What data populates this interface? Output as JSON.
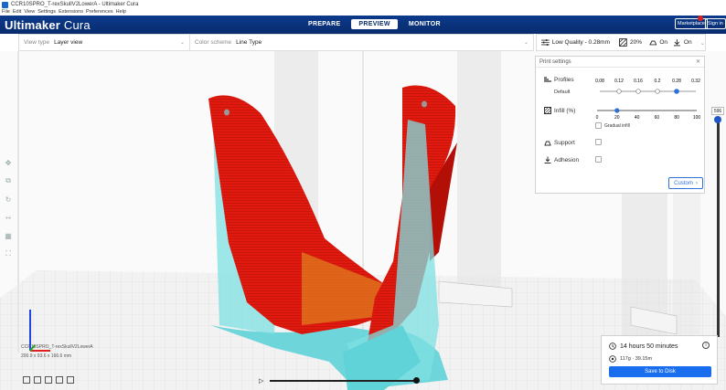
{
  "window": {
    "title": "CCR10SPRO_T-rexSkullV2LowerA - Ultimaker Cura",
    "menu": [
      "File",
      "Edit",
      "View",
      "Settings",
      "Extensions",
      "Preferences",
      "Help"
    ]
  },
  "header": {
    "logo_brand": "Ultimaker",
    "logo_product": " Cura",
    "stages": [
      "PREPARE",
      "PREVIEW",
      "MONITOR"
    ],
    "active_stage": "PREVIEW",
    "marketplace_label": "Marketplace",
    "signin_label": "Sign in"
  },
  "viewbar": {
    "view_type_label": "View type",
    "view_type_value": "Layer view",
    "color_scheme_label": "Color scheme",
    "color_scheme_value": "Line Type"
  },
  "quality": {
    "profile": "Low Quality - 0.28mm",
    "infill": "20%",
    "support": "On",
    "adhesion": "On"
  },
  "print_settings": {
    "title": "Print settings",
    "profiles_label": "Profiles",
    "default_label": "Default",
    "profile_values": [
      "0.08",
      "0.12",
      "0.16",
      "0.2",
      "0.28",
      "0.32"
    ],
    "selected_profile": "0.28",
    "infill_label": "Infill (%)",
    "infill_ticks": [
      "0",
      "20",
      "40",
      "60",
      "80",
      "100"
    ],
    "infill_value": 20,
    "gradual_infill_label": "Gradual infill",
    "support_label": "Support",
    "adhesion_label": "Adhesion",
    "custom_label": "Custom"
  },
  "layer": {
    "current": "596"
  },
  "object_info": {
    "name": "CCR10SPRO_T-rexSkullV2LowerA",
    "dimensions": "200.9 x 93.6 x 166.6 mm"
  },
  "job": {
    "time": "14 hours 50 minutes",
    "material": "117g · 39.15m",
    "save_label": "Save to Disk"
  },
  "colors": {
    "header": "#0a2c6d",
    "accent": "#196ef0",
    "wall": "#e21d10",
    "support": "#5fd3d8",
    "infill": "#e2a324"
  },
  "icons": {
    "tools": [
      "move-icon",
      "scale-icon",
      "rotate-icon",
      "mirror-icon",
      "per-model-settings-icon",
      "support-blocker-icon"
    ]
  }
}
